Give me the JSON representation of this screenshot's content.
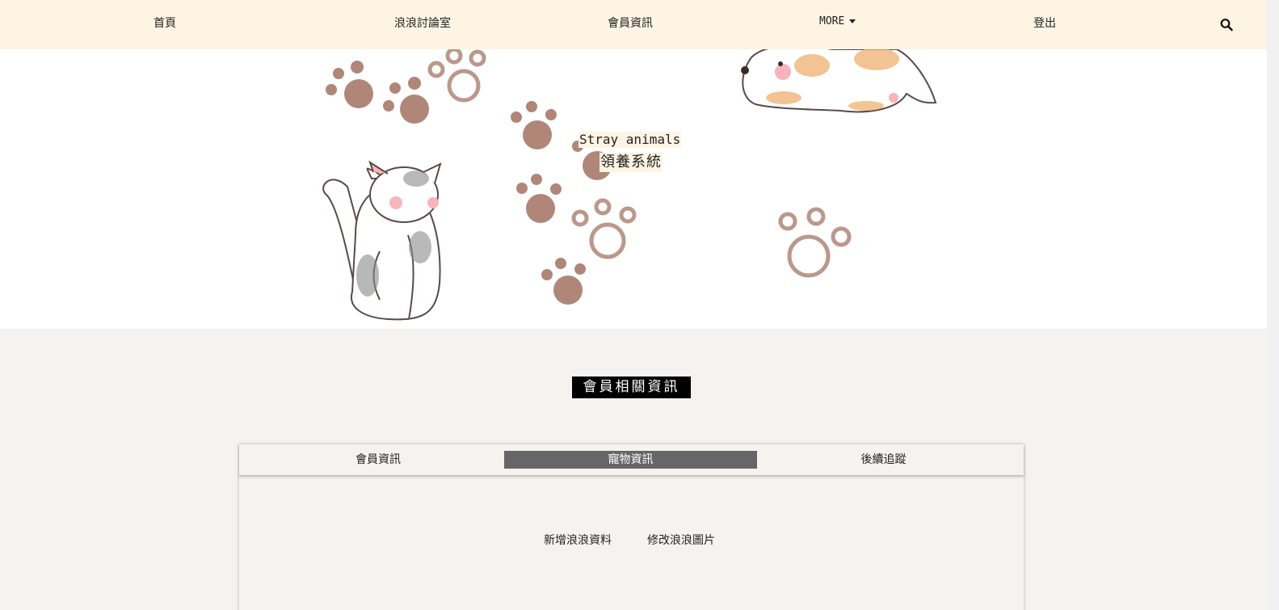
{
  "nav": {
    "home": "首頁",
    "forum": "浪浪討論室",
    "member_info": "會員資訊",
    "more": "MORE",
    "logout": "登出",
    "search_icon": "search-icon"
  },
  "hero": {
    "title": "Stray animals",
    "subtitle": "領養系統",
    "illustrations": [
      "paw-prints",
      "cat",
      "dog"
    ]
  },
  "section": {
    "heading": "會員相關資訊"
  },
  "tabs": {
    "items": [
      "會員資訊",
      "寵物資訊",
      "後續追蹤"
    ],
    "active": "寵物資訊"
  },
  "panel": {
    "add_stray": "新增浪浪資料",
    "edit_stray_photo": "修改浪浪圖片"
  },
  "colors": {
    "navbar_bg": "#fdf4e3",
    "page_bg": "#f5f3ef",
    "paw": "#b08678",
    "active_tab": "#666666"
  }
}
